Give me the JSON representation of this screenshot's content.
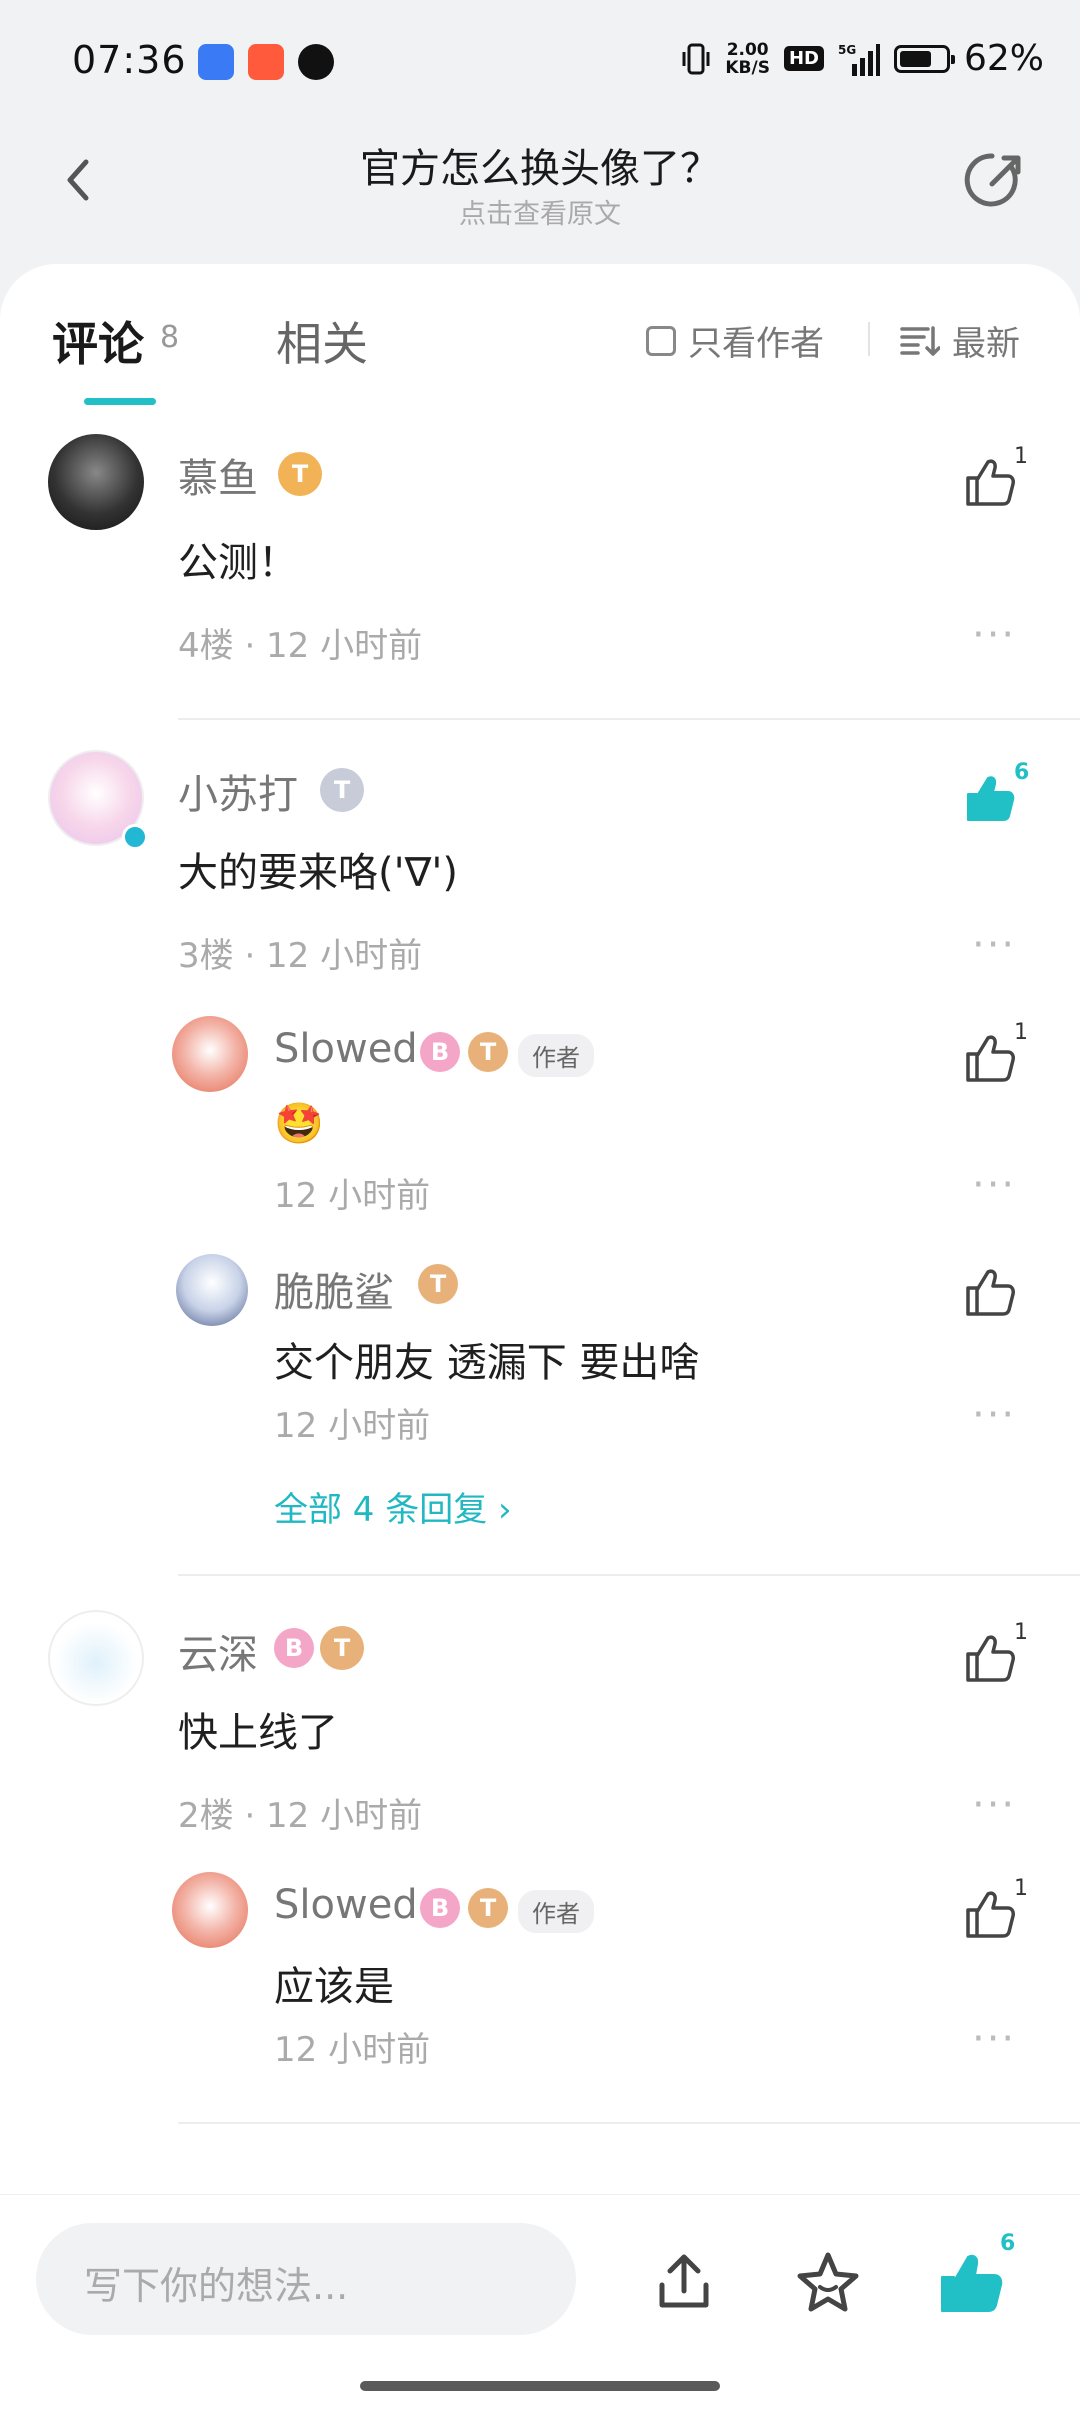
{
  "status": {
    "time": "07:36",
    "net_speed_top": "2.00",
    "net_speed_bottom": "KB/S",
    "hd": "HD",
    "signal": "5G",
    "battery": "62%",
    "battery_level": 0.62
  },
  "header": {
    "title": "官方怎么换头像了？",
    "subtitle": "点击查看原文"
  },
  "tabs": {
    "comments_label": "评论",
    "comments_count": "8",
    "related_label": "相关",
    "author_only_label": "只看作者",
    "sort_label": "最新"
  },
  "comments": [
    {
      "username": "慕鱼",
      "level": "T",
      "text": "公测！",
      "meta": "4楼 · 12 小时前",
      "likes": "1"
    },
    {
      "username": "小苏打",
      "level": "T",
      "text": "大的要来咯('∇')",
      "meta": "3楼 · 12 小时前",
      "likes": "6",
      "replies": [
        {
          "username": "Slowed",
          "level": "T",
          "tag": "作者",
          "text": "🤩",
          "meta": "12 小时前",
          "likes": "1"
        },
        {
          "username": "脆脆鲨",
          "level": "T",
          "text": "交个朋友 透漏下 要出啥",
          "meta": "12 小时前",
          "likes": ""
        }
      ],
      "more_replies": "全部 4 条回复 ›"
    },
    {
      "username": "云深",
      "level": "T",
      "text": "快上线了",
      "meta": "2楼 · 12 小时前",
      "likes": "1",
      "replies": [
        {
          "username": "Slowed",
          "level": "T",
          "tag": "作者",
          "text": "应该是",
          "meta": "12 小时前",
          "likes": "1"
        }
      ]
    }
  ],
  "bottom": {
    "input_placeholder": "写下你的想法...",
    "like_count": "6"
  },
  "colors": {
    "accent": "#21c0c6",
    "background": "#f1f2f4"
  }
}
